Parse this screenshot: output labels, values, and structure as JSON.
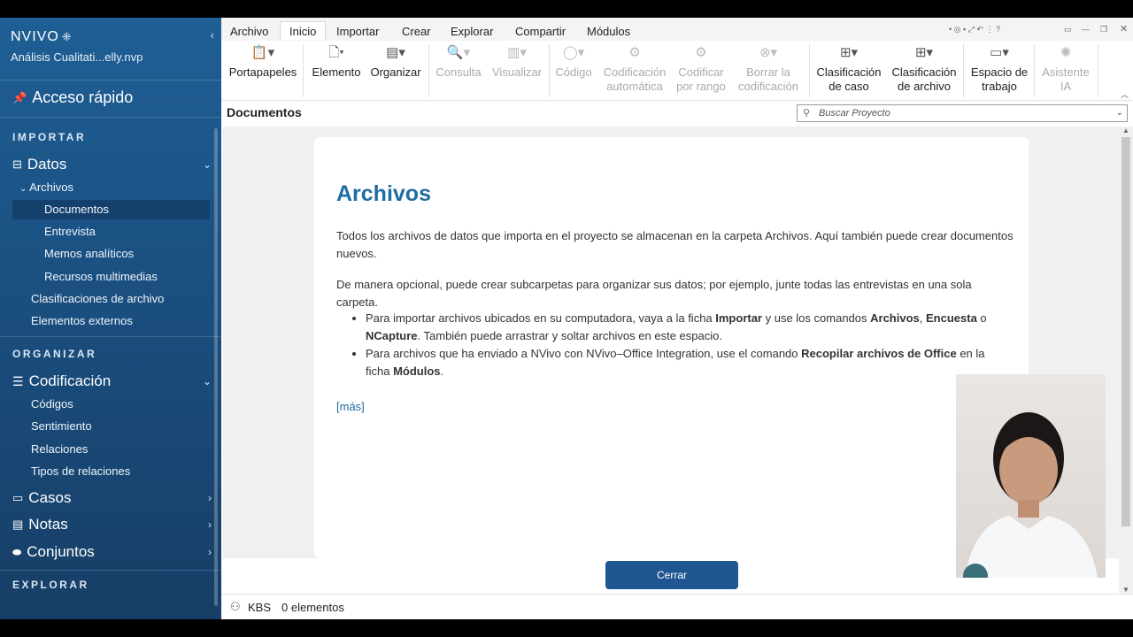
{
  "app": {
    "brand": "NVIVO",
    "project": "Análisis Cualitati...elly.nvp"
  },
  "sidebar": {
    "quick_access": "Acceso rápido",
    "sections": {
      "importar": "IMPORTAR",
      "organizar": "ORGANIZAR",
      "explorar": "EXPLORAR"
    },
    "datos": "Datos",
    "archivos": "Archivos",
    "archivos_items": [
      "Documentos",
      "Entrevista",
      "Memos analíticos",
      "Recursos multimedias"
    ],
    "clasificaciones_archivo": "Clasificaciones de archivo",
    "elementos_externos": "Elementos externos",
    "codificacion": "Codificación",
    "codificacion_items": [
      "Códigos",
      "Sentimiento",
      "Relaciones",
      "Tipos de relaciones"
    ],
    "casos": "Casos",
    "notas": "Notas",
    "conjuntos": "Conjuntos",
    "selected": "Documentos"
  },
  "menu": {
    "tabs": [
      "Archivo",
      "Inicio",
      "Importar",
      "Crear",
      "Explorar",
      "Compartir",
      "Módulos"
    ],
    "active": "Inicio"
  },
  "ribbon": {
    "portapapeles": "Portapapeles",
    "elemento": "Elemento",
    "organizar": "Organizar",
    "consulta": "Consulta",
    "visualizar": "Visualizar",
    "codigo": "Código",
    "codificacion_auto": [
      "Codificación",
      "automática"
    ],
    "codificar_rango": [
      "Codificar",
      "por rango"
    ],
    "borrar_cod": [
      "Borrar la",
      "codificación"
    ],
    "clasif_caso": [
      "Clasificación",
      "de caso"
    ],
    "clasif_archivo": [
      "Clasificación",
      "de archivo"
    ],
    "espacio": [
      "Espacio de",
      "trabajo"
    ],
    "asistente": [
      "Asistente",
      "IA"
    ]
  },
  "content": {
    "title": "Documentos",
    "search_placeholder": "Buscar Proyecto",
    "heading": "Archivos",
    "p1": "Todos los archivos de datos que importa en el proyecto se almacenan en la carpeta Archivos. Aquí también puede crear documentos nuevos.",
    "p2": "De manera opcional, puede crear subcarpetas para organizar sus datos; por ejemplo, junte todas las entrevistas en una sola carpeta.",
    "b1": {
      "t1": "Para importar archivos ubicados en su computadora, vaya a la ficha ",
      "s1": "Importar",
      "t2": " y use los comandos ",
      "s2": "Archivos",
      "t3": ", ",
      "s3": "Encuesta",
      "t4": " o ",
      "s4": "NCapture",
      "t5": ". También puede arrastrar y soltar archivos en este espacio."
    },
    "b2": {
      "t1": "Para archivos que ha enviado a NVivo con NVivo–Office Integration, use el comando ",
      "s1": "Recopilar archivos de Office",
      "t2": " en la ficha ",
      "s2": "Módulos",
      "t3": "."
    },
    "more": "[más]",
    "close_button": "Cerrar"
  },
  "status": {
    "user": "KBS",
    "count": "0 elementos"
  },
  "colors": {
    "sidebar": "#1f5f95",
    "accent": "#1f6da1",
    "button": "#1f5590"
  }
}
